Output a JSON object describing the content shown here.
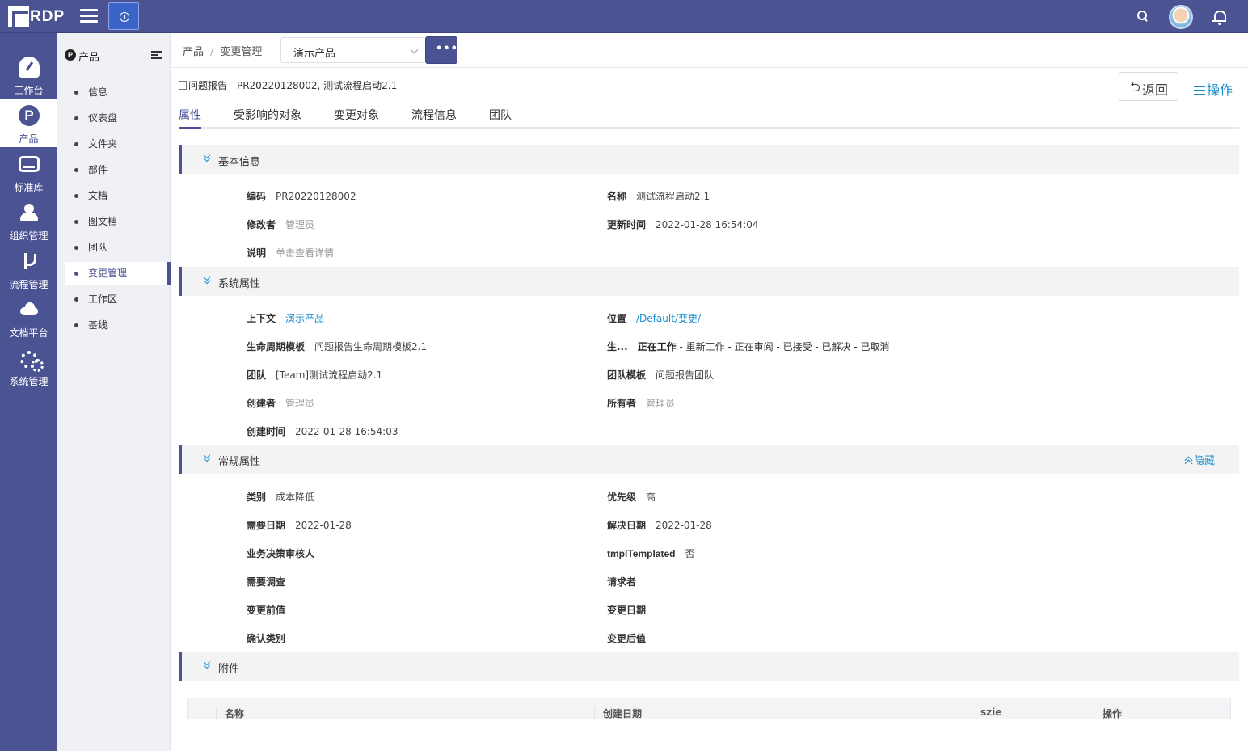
{
  "app": {
    "logo": "RDP"
  },
  "rail": {
    "items": [
      {
        "label": "工作台"
      },
      {
        "label": "产品"
      },
      {
        "label": "标准库"
      },
      {
        "label": "组织管理"
      },
      {
        "label": "流程管理"
      },
      {
        "label": "文档平台"
      },
      {
        "label": "系统管理"
      }
    ]
  },
  "sidebar": {
    "badge": "P",
    "title": "产品",
    "items": [
      {
        "label": "信息"
      },
      {
        "label": "仪表盘"
      },
      {
        "label": "文件夹"
      },
      {
        "label": "部件"
      },
      {
        "label": "文档"
      },
      {
        "label": "图文档"
      },
      {
        "label": "团队"
      },
      {
        "label": "变更管理"
      },
      {
        "label": "工作区"
      },
      {
        "label": "基线"
      }
    ]
  },
  "breadcrumb": {
    "root": "产品",
    "sep": "/",
    "current": "变更管理"
  },
  "context_select": {
    "value": "演示产品"
  },
  "more_button": "•••",
  "object_title": "问题报告 - PR20220128002, 测试流程启动2.1",
  "actions": {
    "back": "返回",
    "back_arrow": "⮌",
    "ops": "操作"
  },
  "tabs": [
    "属性",
    "受影响的对象",
    "变更对象",
    "流程信息",
    "团队"
  ],
  "sections": {
    "basic": {
      "title": "基本信息",
      "fields": {
        "code": {
          "k": "编码",
          "v": "PR20220128002"
        },
        "name": {
          "k": "名称",
          "v": "测试流程启动2.1"
        },
        "modifier": {
          "k": "修改者",
          "v": "管理员"
        },
        "updated": {
          "k": "更新时间",
          "v": "2022-01-28 16:54:04"
        },
        "desc": {
          "k": "说明",
          "v": "单击查看详情"
        }
      }
    },
    "system": {
      "title": "系统属性",
      "fields": {
        "context": {
          "k": "上下文",
          "v": "演示产品"
        },
        "location": {
          "k": "位置",
          "v": "/Default/变更/"
        },
        "lifecycle_tpl": {
          "k": "生命周期模板",
          "v": "问题报告生命周期模板2.1"
        },
        "lifecycle": {
          "k": "生...",
          "v_strong": "正在工作",
          "v": " - 重新工作 - 正在审阅 - 已接受 - 已解决 - 已取消"
        },
        "team": {
          "k": "团队",
          "v": "[Team]测试流程启动2.1"
        },
        "team_tpl": {
          "k": "团队模板",
          "v": "问题报告团队"
        },
        "creator": {
          "k": "创建者",
          "v": "管理员"
        },
        "owner": {
          "k": "所有者",
          "v": "管理员"
        },
        "created": {
          "k": "创建时间",
          "v": "2022-01-28 16:54:03"
        }
      }
    },
    "general": {
      "title": "常规属性",
      "hide": "隐藏",
      "fields": {
        "category": {
          "k": "类别",
          "v": "成本降低"
        },
        "priority": {
          "k": "优先级",
          "v": "高"
        },
        "need_date": {
          "k": "需要日期",
          "v": "2022-01-28"
        },
        "resolve_date": {
          "k": "解决日期",
          "v": "2022-01-28"
        },
        "biz_reviewer": {
          "k": "业务决策审核人",
          "v": ""
        },
        "tmpl": {
          "k": "tmplTemplated",
          "v": "否"
        },
        "need_survey": {
          "k": "需要调查",
          "v": ""
        },
        "requester": {
          "k": "请求者",
          "v": ""
        },
        "before_value": {
          "k": "变更前值",
          "v": ""
        },
        "change_date": {
          "k": "变更日期",
          "v": ""
        },
        "confirm_category": {
          "k": "确认类别",
          "v": ""
        },
        "after_value": {
          "k": "变更后值",
          "v": ""
        }
      }
    },
    "attachments": {
      "title": "附件",
      "columns": [
        "名称",
        "创建日期",
        "szie",
        "操作"
      ]
    }
  }
}
